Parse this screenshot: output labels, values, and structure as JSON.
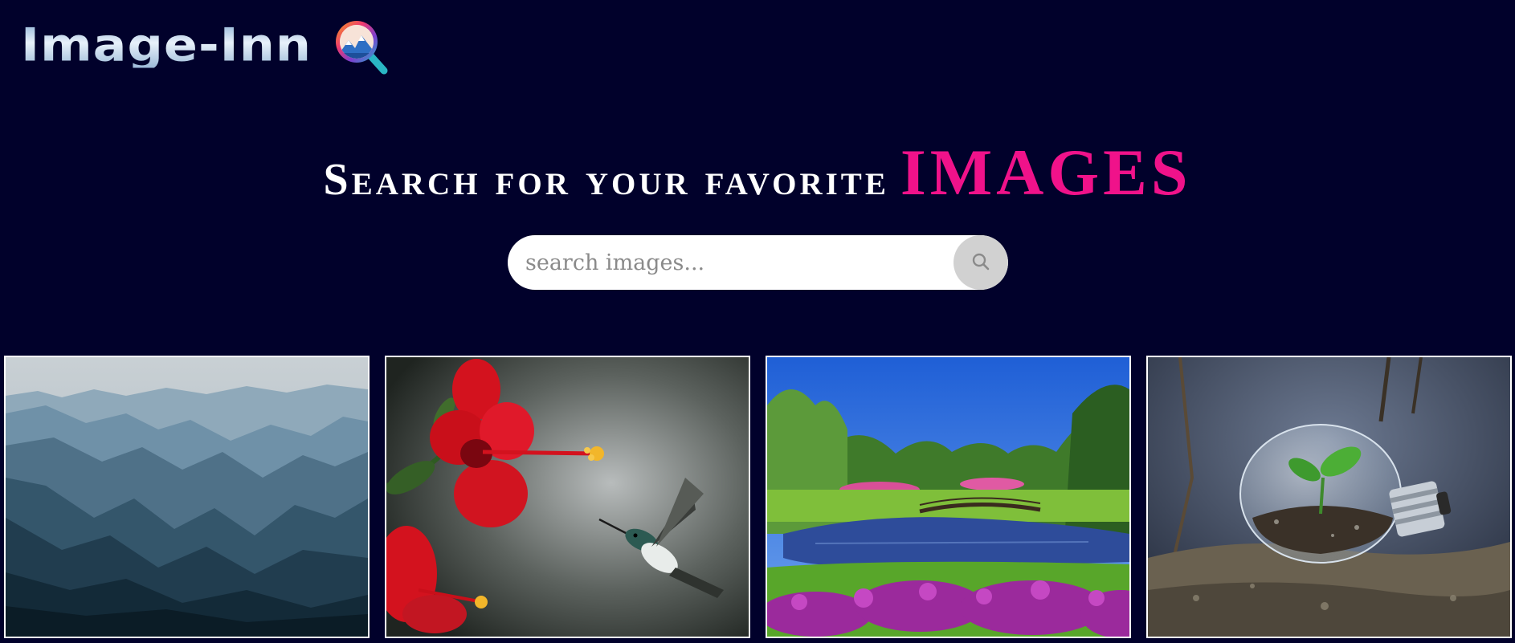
{
  "header": {
    "logo_text": "Image-Inn",
    "logo_icon": "magnifier-mountain-logo-icon"
  },
  "hero": {
    "lead": "Search for your favorite",
    "accent": "IMAGES",
    "accent_color": "#f0128a"
  },
  "search": {
    "placeholder": "search images...",
    "value": "",
    "button_icon": "search-icon"
  },
  "gallery": {
    "items": [
      {
        "subject": "misty blue mountain ranges"
      },
      {
        "subject": "red hibiscus flower with hummingbird"
      },
      {
        "subject": "park pond with footbridge and purple flowers"
      },
      {
        "subject": "light bulb terrarium with sprout on soil"
      }
    ]
  },
  "colors": {
    "background": "#01012b",
    "card_border": "#ffffff",
    "search_button": "#d1d1d1"
  }
}
